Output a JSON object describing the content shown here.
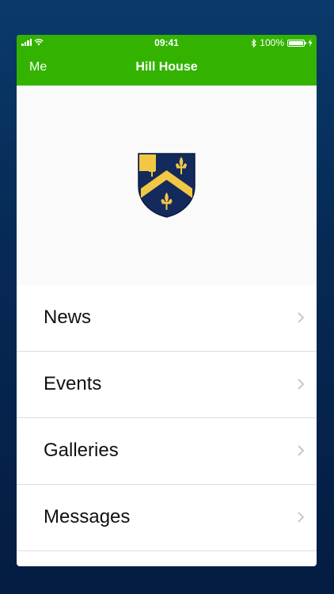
{
  "status_bar": {
    "time": "09:41",
    "battery_percent": "100%",
    "battery_level": 1.0,
    "icons": [
      "signal-icon",
      "wifi-icon",
      "bluetooth-icon",
      "battery-icon",
      "charging-icon"
    ]
  },
  "nav": {
    "back_label": "Me",
    "title": "Hill House"
  },
  "hero": {
    "logo": "school-crest-icon"
  },
  "menu": {
    "items": [
      {
        "label": "News"
      },
      {
        "label": "Events"
      },
      {
        "label": "Galleries"
      },
      {
        "label": "Messages"
      }
    ]
  },
  "colors": {
    "accent": "#33b300",
    "background_top": "#0a3a6b",
    "background_bottom": "#041c42",
    "crest_navy": "#142a5c",
    "crest_gold": "#f2c744"
  }
}
